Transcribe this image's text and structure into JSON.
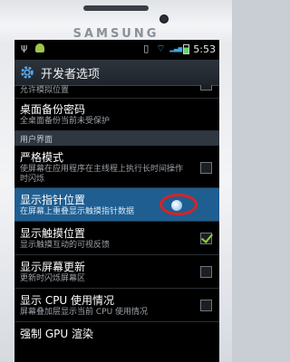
{
  "device": {
    "brand": "SAMSUNG"
  },
  "status_bar": {
    "time": "5:53"
  },
  "title_bar": {
    "title": "开发者选项"
  },
  "items": [
    {
      "title": "",
      "subtitle": "允许模拟位置",
      "checked": false
    },
    {
      "title": "桌面备份密码",
      "subtitle": "全桌面备份当前未受保护",
      "checked": null
    },
    {
      "section": "用户界面"
    },
    {
      "title": "严格模式",
      "subtitle": "使屏幕在应用程序在主线程上执行长时间操作时闪烁",
      "checked": false
    },
    {
      "title": "显示指针位置",
      "subtitle": "在屏幕上重叠显示触摸指针数据",
      "checked": false
    },
    {
      "title": "显示触摸位置",
      "subtitle": "显示触摸互动的可视反馈",
      "checked": true
    },
    {
      "title": "显示屏幕更新",
      "subtitle": "更新时闪烁屏幕区",
      "checked": false
    },
    {
      "title": "显示 CPU 使用情况",
      "subtitle": "屏幕叠加层显示当前 CPU 使用情况",
      "checked": false
    },
    {
      "title": "强制 GPU 渲染",
      "subtitle": "",
      "checked": null
    }
  ],
  "icons": [
    "usb-icon",
    "android-icon",
    "vibrate-icon",
    "wifi-icon",
    "signal-icon",
    "battery-icon",
    "gear-icon"
  ]
}
